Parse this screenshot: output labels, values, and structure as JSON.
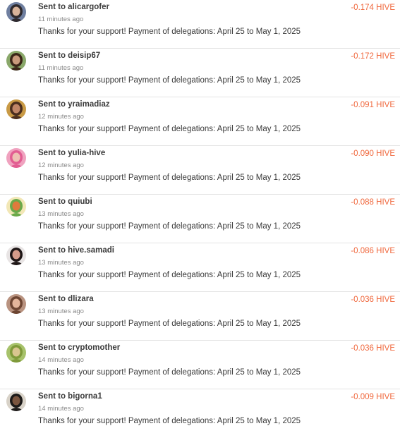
{
  "transfers": [
    {
      "title": "Sent to alicargofer",
      "time": "11 minutes ago",
      "memo": "Thanks for your support! Payment of delegations: April 25 to May 1, 2025",
      "amount": "-0.174 HIVE",
      "avatar": {
        "bg": "#6f7fa0",
        "face": "#d8b39a",
        "hair": "#2f2a2e"
      }
    },
    {
      "title": "Sent to deisip67",
      "time": "11 minutes ago",
      "memo": "Thanks for your support! Payment of delegations: April 25 to May 1, 2025",
      "amount": "-0.172 HIVE",
      "avatar": {
        "bg": "#8aa86a",
        "face": "#c99a7c",
        "hair": "#3b2618"
      }
    },
    {
      "title": "Sent to yraimadiaz",
      "time": "12 minutes ago",
      "memo": "Thanks for your support! Payment of delegations: April 25 to May 1, 2025",
      "amount": "-0.091 HIVE",
      "avatar": {
        "bg": "#c99a45",
        "face": "#c08567",
        "hair": "#4a2d1e"
      }
    },
    {
      "title": "Sent to yulia-hive",
      "time": "12 minutes ago",
      "memo": "Thanks for your support! Payment of delegations: April 25 to May 1, 2025",
      "amount": "-0.090 HIVE",
      "avatar": {
        "bg": "#f0a2bf",
        "face": "#eec0b4",
        "hair": "#e25d92"
      }
    },
    {
      "title": "Sent to quiubi",
      "time": "13 minutes ago",
      "memo": "Thanks for your support! Payment of delegations: April 25 to May 1, 2025",
      "amount": "-0.088 HIVE",
      "avatar": {
        "bg": "#f2e7b6",
        "face": "#e07a3c",
        "hair": "#6aa94a"
      }
    },
    {
      "title": "Sent to hive.samadi",
      "time": "13 minutes ago",
      "memo": "Thanks for your support! Payment of delegations: April 25 to May 1, 2025",
      "amount": "-0.086 HIVE",
      "avatar": {
        "bg": "#e8e4e4",
        "face": "#d59b8a",
        "hair": "#1e1616"
      }
    },
    {
      "title": "Sent to dlizara",
      "time": "13 minutes ago",
      "memo": "Thanks for your support! Payment of delegations: April 25 to May 1, 2025",
      "amount": "-0.036 HIVE",
      "avatar": {
        "bg": "#b99380",
        "face": "#e3b59b",
        "hair": "#6d4532"
      }
    },
    {
      "title": "Sent to cryptomother",
      "time": "14 minutes ago",
      "memo": "Thanks for your support! Payment of delegations: April 25 to May 1, 2025",
      "amount": "-0.036 HIVE",
      "avatar": {
        "bg": "#a7c26b",
        "face": "#d9c690",
        "hair": "#7f9a3a"
      }
    },
    {
      "title": "Sent to bigorna1",
      "time": "14 minutes ago",
      "memo": "Thanks for your support! Payment of delegations: April 25 to May 1, 2025",
      "amount": "-0.009 HIVE",
      "avatar": {
        "bg": "#d8d2c8",
        "face": "#7a553f",
        "hair": "#1c1a19"
      }
    }
  ]
}
